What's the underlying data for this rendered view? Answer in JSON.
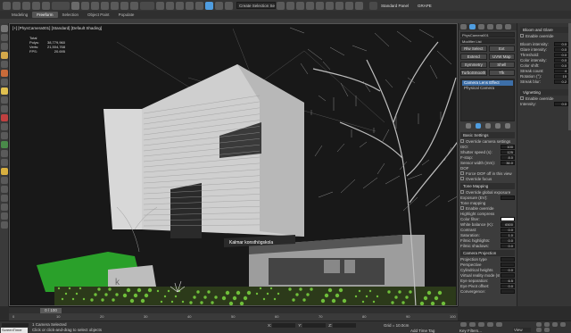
{
  "menu_tabs": [
    {
      "label": "Modeling",
      "active": false
    },
    {
      "label": "Freeform",
      "active": true
    },
    {
      "label": "Selection",
      "active": false
    },
    {
      "label": "Object Paint",
      "active": false
    },
    {
      "label": "Populate",
      "active": false
    }
  ],
  "toolbar": {
    "selection_set": "Create Selection Se",
    "workspace": "Standard Panel",
    "user": "GRAPE",
    "view_mode": "View"
  },
  "viewport": {
    "label": "[+] [PhysCamera001] [Standard] [Default Shading]",
    "stats": [
      {
        "k": "Total",
        "v": ""
      },
      {
        "k": "Polys:",
        "v": "38,779,960"
      },
      {
        "k": "Verts:",
        "v": "21,504,768"
      },
      {
        "k": "FPS:",
        "v": "20.695"
      }
    ],
    "sign_text": "Kalmar konsthögskola"
  },
  "command_panel": {
    "object_name": "PhysCamera001",
    "modifier_list": "Modifier List",
    "buttons": [
      "Rlw Select",
      "Ext",
      "Extend",
      "UVW Map",
      "Symmetry",
      "Shell",
      "TurboSmooth",
      "Tfk"
    ],
    "stack": [
      "Camera Lens Effect",
      "Physical Camera"
    ],
    "basic_settings": {
      "title": "Basic Settings",
      "override": "Override camera settings",
      "rows": [
        {
          "k": "ISO:",
          "v": "100"
        },
        {
          "k": "Shutter speed (s):",
          "v": "125"
        },
        {
          "k": "F-stop:",
          "v": "8.0"
        },
        {
          "k": "Sensor width (mm):",
          "v": "36.0"
        }
      ],
      "dof_label": "DOF",
      "dof_opt": "Force DOF off in this view",
      "override_focus": "Override focus"
    },
    "tone_mapping": {
      "title": "Tone Mapping",
      "override": "Override global exposure",
      "exposure": "Exposure (EV):",
      "tone": "Tone mapping",
      "enable": "Enable override",
      "highlight": "Highlight compress",
      "rows": [
        {
          "k": "Color filter:",
          "v": ""
        },
        {
          "k": "White balance (K):",
          "v": "6500"
        },
        {
          "k": "Contrast:",
          "v": "0.0"
        },
        {
          "k": "Saturation:",
          "v": "1.0"
        },
        {
          "k": "Filmic highlights:",
          "v": "0.0"
        },
        {
          "k": "Filmic shadows:",
          "v": "0.0"
        }
      ]
    },
    "camera_projection": {
      "title": "Camera Projection",
      "rows": [
        {
          "k": "Projection type",
          "v": ""
        },
        {
          "k": "Perspective",
          "v": ""
        },
        {
          "k": "Cylindrical heights",
          "v": "0.0"
        },
        {
          "k": "Virtual reality mode (stereo)",
          "v": ""
        },
        {
          "k": "Eye separation:",
          "v": "6.5"
        },
        {
          "k": "Eye Pivot offset:",
          "v": "0.0"
        },
        {
          "k": "Convergence:",
          "v": ""
        }
      ]
    }
  },
  "right_panel": {
    "bloom_title": "Bloom and Glare",
    "enable_override": "Enable override",
    "bloom_rows": [
      {
        "k": "Bloom intensity:",
        "v": "0.0"
      },
      {
        "k": "Glare intensity:",
        "v": "0.0"
      },
      {
        "k": "Threshold:",
        "v": "0.0"
      },
      {
        "k": "Color intensity:",
        "v": "0.0"
      },
      {
        "k": "Color shift:",
        "v": "0.0"
      },
      {
        "k": "Streak count:",
        "v": "4"
      },
      {
        "k": "Rotation (°):",
        "v": "15"
      },
      {
        "k": "Streak blur:",
        "v": "0.2"
      }
    ],
    "vignette_title": "Vignetting",
    "vignette_enable": "Enable override",
    "intensity": "Intensity:",
    "intensity_v": "0.0"
  },
  "timeline": {
    "frame": "0 / 100",
    "ticks": [
      "0",
      "10",
      "20",
      "30",
      "40",
      "50",
      "60",
      "70",
      "80",
      "90",
      "100"
    ],
    "status1": "1 Camera Selected",
    "status2": "Click or click-and-drag to select objects",
    "coords": [
      {
        "k": "X:",
        "v": ""
      },
      {
        "k": "Y:",
        "v": ""
      },
      {
        "k": "Z:",
        "v": ""
      }
    ],
    "grid": "Grid = 10.0cm",
    "add_tag": "Add Time Tag",
    "key_filters": "Key Filters...",
    "watermark": "ScreenTimer"
  },
  "colors": {
    "accent": "#4f9de0",
    "bg": "#2b2b2b",
    "selection": "#3d6fa8"
  }
}
